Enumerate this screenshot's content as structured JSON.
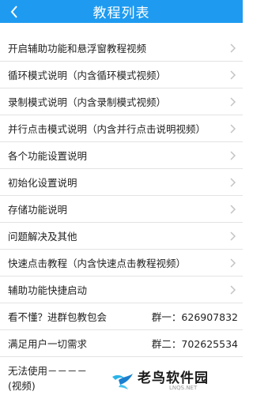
{
  "header": {
    "title": "教程列表"
  },
  "items": [
    {
      "label": "开启辅助功能和悬浮窗教程视频"
    },
    {
      "label": "循环模式说明（内含循环模式视频）"
    },
    {
      "label": "录制模式说明（内含录制模式视频）"
    },
    {
      "label": "并行点击模式说明（内含并行点击说明视频）"
    },
    {
      "label": "各个功能设置说明"
    },
    {
      "label": "初始化设置说明"
    },
    {
      "label": "存储功能说明"
    },
    {
      "label": "问题解决及其他"
    },
    {
      "label": "快速点击教程（内含快速点击教程视频）"
    },
    {
      "label": "辅助功能快捷启动"
    }
  ],
  "info": [
    {
      "left": "看不懂？进群包教包会",
      "right": "群一：626907832"
    },
    {
      "left": "满足用户一切需求",
      "right": "群二：702625534"
    }
  ],
  "last": {
    "label": "无法使用－－－－(视频)"
  },
  "watermark": {
    "title": "老鸟软件园",
    "sub": "LNQS.NET"
  }
}
